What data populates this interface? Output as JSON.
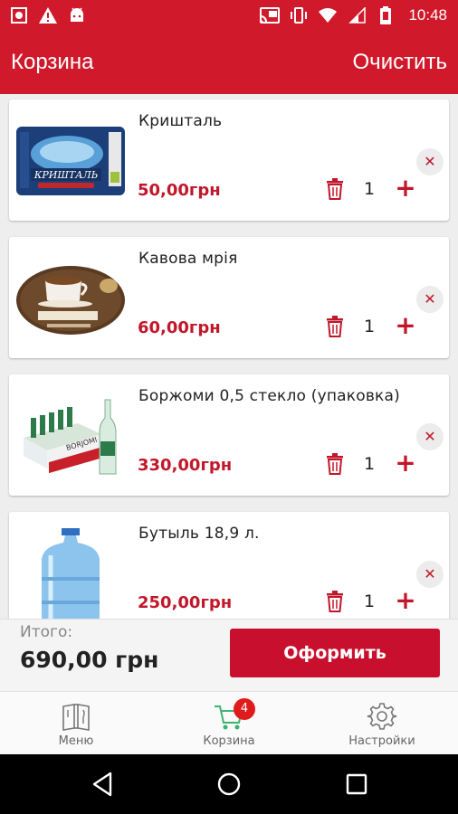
{
  "status_bar": {
    "time": "10:48",
    "left_icons": [
      "screenshot-icon",
      "warning-icon",
      "android-icon"
    ],
    "right_icons": [
      "cast-icon",
      "vibrate-icon",
      "wifi-icon",
      "signal-icon",
      "battery-icon"
    ]
  },
  "app_bar": {
    "title": "Корзина",
    "clear_label": "Очистить"
  },
  "cart_items": [
    {
      "name": "Кришталь",
      "price": "50,00грн",
      "quantity": "1",
      "thumbnail": "kryshtal-water-label"
    },
    {
      "name": "Кавова мрія",
      "price": "60,00грн",
      "quantity": "1",
      "thumbnail": "coffee-cup-label"
    },
    {
      "name": "Боржоми 0,5 стекло (упаковка)",
      "price": "330,00грн",
      "quantity": "1",
      "thumbnail": "borjomi-bottles-pack"
    },
    {
      "name": "Бутыль 18,9 л.",
      "price": "250,00грн",
      "quantity": "1",
      "thumbnail": "water-jug-bottle"
    }
  ],
  "total": {
    "label": "Итого:",
    "value": "690,00 грн",
    "checkout_label": "Оформить"
  },
  "bottom_nav": {
    "items": [
      {
        "label": "Меню",
        "icon": "menu-book-icon"
      },
      {
        "label": "Корзина",
        "icon": "cart-icon",
        "badge": "4",
        "active": true
      },
      {
        "label": "Настройки",
        "icon": "gear-icon"
      }
    ]
  },
  "colors": {
    "primary": "#d01a2b",
    "price": "#c2172a",
    "active_nav": "#3cb371"
  }
}
